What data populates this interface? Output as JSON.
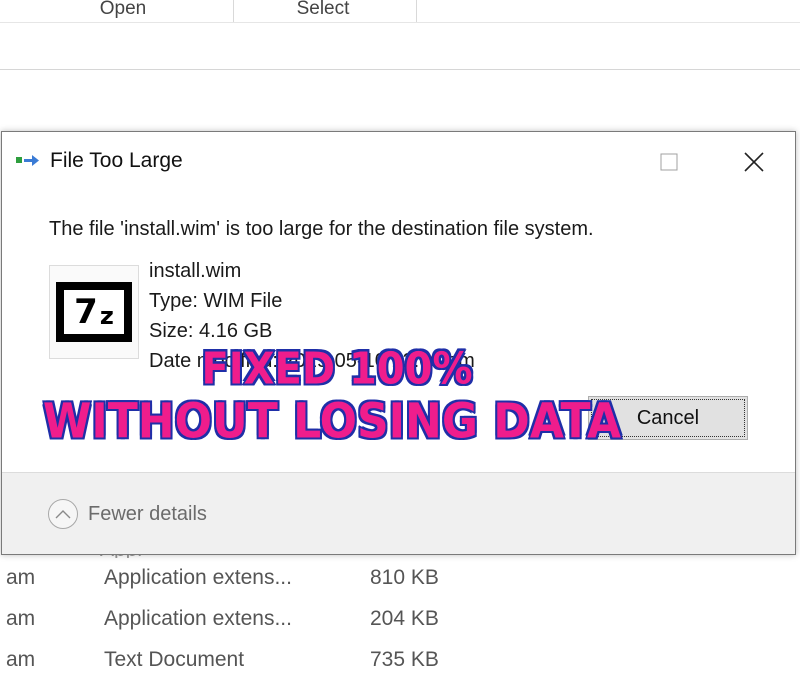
{
  "explorer": {
    "ribbon": {
      "open_label": "Open",
      "select_label": "Select"
    },
    "partial_row_text": "Appl",
    "files": [
      {
        "time": "am",
        "type": "Application extens...",
        "size": "810 KB"
      },
      {
        "time": "am",
        "type": "Application extens...",
        "size": "204 KB"
      },
      {
        "time": "am",
        "type": "Text Document",
        "size": "735 KB"
      }
    ]
  },
  "dialog": {
    "title": "File Too Large",
    "message": "The file 'install.wim' is too large for the destination file system.",
    "file": {
      "name": "install.wim",
      "type": "Type: WIM File",
      "size": "Size: 4.16 GB",
      "date": "Date modified: 2019-05-10 12:00 am"
    },
    "icon_glyph_main": "7",
    "icon_glyph_sub": "z",
    "cancel_label": "Cancel",
    "fewer_details_label": "Fewer details"
  },
  "overlay": {
    "line1": "FIXED 100%",
    "line2": "WITHOUT LOSING DATA",
    "fill_color": "#ef1d8c",
    "stroke_color": "#1f2fa8"
  },
  "icons": {
    "app": "copy-transfer-icon",
    "minimize": "minimize-icon",
    "maximize": "maximize-icon",
    "close": "close-icon",
    "file": "7zip-icon",
    "chevron": "chevron-up-icon"
  }
}
